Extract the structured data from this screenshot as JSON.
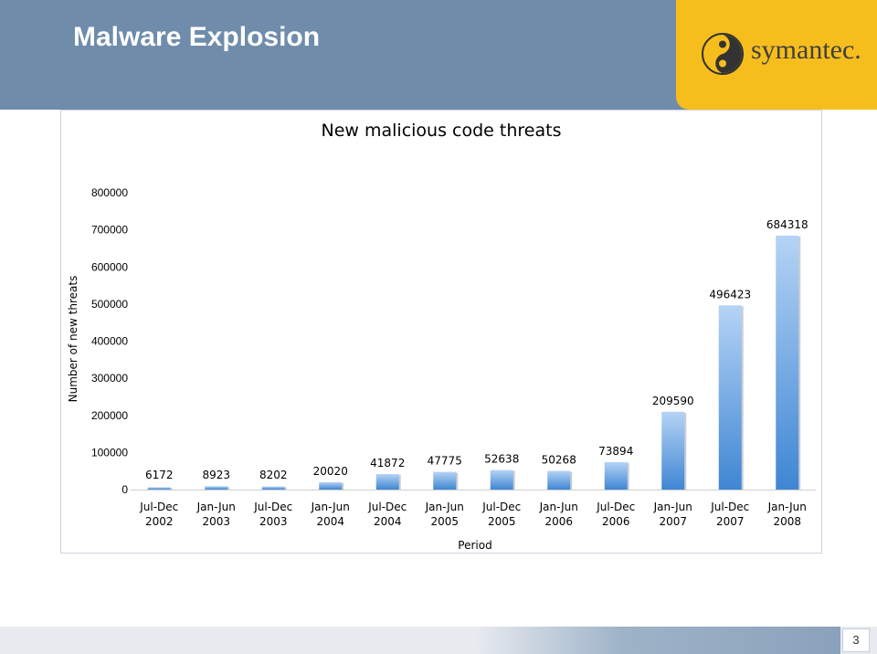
{
  "slide": {
    "title": "Malware Explosion",
    "logo_text": "symantec.",
    "page_number": "3"
  },
  "colors": {
    "header_bg": "#6f8cab",
    "logo_bg": "#f6be1c",
    "bar_light": "#b5d3f5",
    "bar_dark": "#3f86d3"
  },
  "chart_data": {
    "type": "bar",
    "title": "New malicious code threats",
    "xlabel": "Period",
    "ylabel": "Number of new threats",
    "ylim": [
      0,
      800000
    ],
    "yticks": [
      "0",
      "100000",
      "200000",
      "300000",
      "400000",
      "500000",
      "600000",
      "700000",
      "800000"
    ],
    "categories": [
      [
        "Jul-Dec",
        "2002"
      ],
      [
        "Jan-Jun",
        "2003"
      ],
      [
        "Jul-Dec",
        "2003"
      ],
      [
        "Jan-Jun",
        "2004"
      ],
      [
        "Jul-Dec",
        "2004"
      ],
      [
        "Jan-Jun",
        "2005"
      ],
      [
        "Jul-Dec",
        "2005"
      ],
      [
        "Jan-Jun",
        "2006"
      ],
      [
        "Jul-Dec",
        "2006"
      ],
      [
        "Jan-Jun",
        "2007"
      ],
      [
        "Jul-Dec",
        "2007"
      ],
      [
        "Jan-Jun",
        "2008"
      ]
    ],
    "values": [
      6172,
      8923,
      8202,
      20020,
      41872,
      47775,
      52638,
      50268,
      73894,
      209590,
      496423,
      684318
    ],
    "value_labels": [
      "6172",
      "8923",
      "8202",
      "20020",
      "41872",
      "47775",
      "52638",
      "50268",
      "73894",
      "209590",
      "496423",
      "684318"
    ],
    "grid": false,
    "legend": "none"
  }
}
